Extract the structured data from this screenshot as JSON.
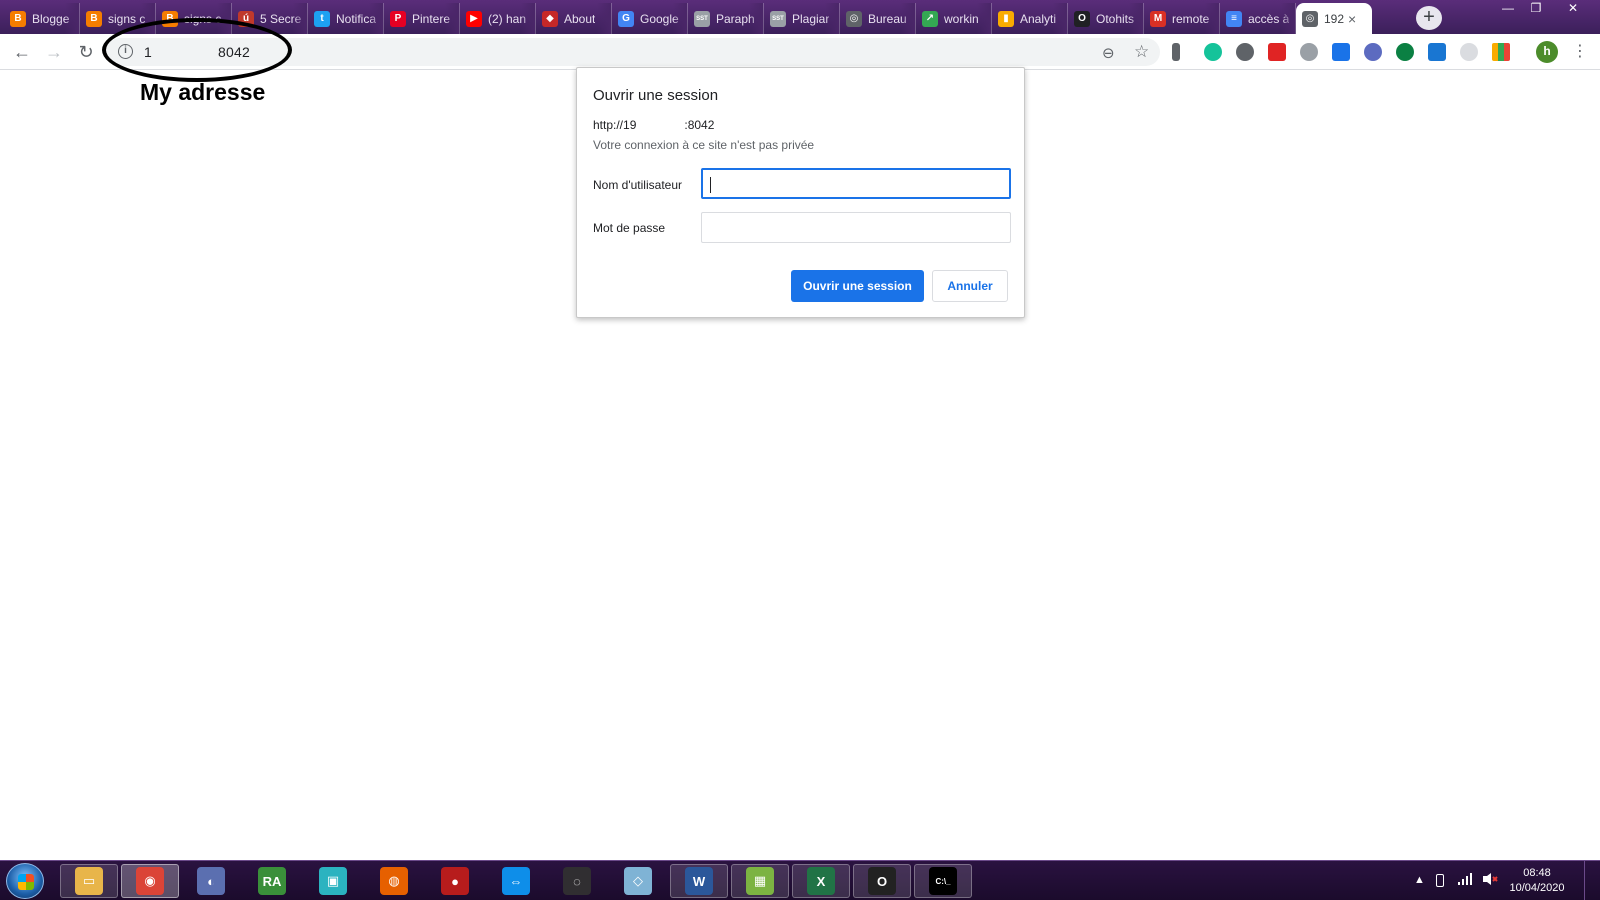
{
  "browser": {
    "tabs": [
      {
        "label": "Blogge",
        "icon": "blogger-icon",
        "color": "#f57d00",
        "glyph": "B"
      },
      {
        "label": "signs c",
        "icon": "blogger-icon",
        "color": "#f57d00",
        "glyph": "B"
      },
      {
        "label": "signs c",
        "icon": "blogger-icon",
        "color": "#f57d00",
        "glyph": "B"
      },
      {
        "label": "5 Secre",
        "icon": "article-icon",
        "color": "#c0392b",
        "glyph": "ú"
      },
      {
        "label": "Notifica",
        "icon": "twitter-icon",
        "color": "#1da1f2",
        "glyph": "t"
      },
      {
        "label": "Pintere",
        "icon": "pinterest-icon",
        "color": "#e60023",
        "glyph": "P"
      },
      {
        "label": "(2) han",
        "icon": "youtube-icon",
        "color": "#ff0000",
        "glyph": "▶"
      },
      {
        "label": "About",
        "icon": "gamepad-icon",
        "color": "#c62828",
        "glyph": "◆"
      },
      {
        "label": "Google",
        "icon": "google-translate-icon",
        "color": "#4285f4",
        "glyph": "G"
      },
      {
        "label": "Paraph",
        "icon": "sst-icon",
        "color": "#9aa0a6",
        "glyph": "SST"
      },
      {
        "label": "Plagiar",
        "icon": "sst-icon",
        "color": "#9aa0a6",
        "glyph": "SST"
      },
      {
        "label": "Bureau",
        "icon": "globe-icon",
        "color": "#5f6368",
        "glyph": "◎"
      },
      {
        "label": "workin",
        "icon": "trend-icon",
        "color": "#34a853",
        "glyph": "↗"
      },
      {
        "label": "Analyti",
        "icon": "analytics-icon",
        "color": "#f9ab00",
        "glyph": "▮"
      },
      {
        "label": "Otohits",
        "icon": "otohits-icon",
        "color": "#202124",
        "glyph": "O"
      },
      {
        "label": "remote",
        "icon": "gmail-icon",
        "color": "#d93025",
        "glyph": "M"
      },
      {
        "label": "accès à",
        "icon": "docs-icon",
        "color": "#4285f4",
        "glyph": "≡"
      },
      {
        "label": "192",
        "icon": "globe-icon",
        "color": "#5f6368",
        "glyph": "◎",
        "active": true
      }
    ],
    "new_tab_label": "+",
    "window_controls": {
      "minimize": "—",
      "restore": "❐",
      "close": "✕"
    },
    "nav": {
      "back": "←",
      "forward": "→",
      "reload": "↻"
    },
    "omnibox": {
      "url_prefix": "1",
      "url_suffix": "8042",
      "info_glyph": "i",
      "zoom_glyph": "⊖",
      "star_glyph": "☆"
    },
    "profile_initial": "h",
    "menu_glyph": "⋮"
  },
  "annotation": {
    "text": "My adresse"
  },
  "dialog": {
    "title": "Ouvrir une session",
    "url_start": "http://19",
    "url_end": ":8042",
    "subtitle": "Votre connexion à ce site n'est pas privée",
    "username_label": "Nom d'utilisateur",
    "username_value": "",
    "password_label": "Mot de passe",
    "password_value": "",
    "submit_label": "Ouvrir une session",
    "cancel_label": "Annuler"
  },
  "taskbar": {
    "clock_time": "08:48",
    "clock_date": "10/04/2020",
    "tray_arrow": "▲",
    "apps": [
      {
        "name": "file-explorer-icon",
        "glyph": "▭",
        "color": "#e8b54a",
        "style": "boxed"
      },
      {
        "name": "chrome-icon",
        "glyph": "◉",
        "color": "#db4437",
        "style": "pressed"
      },
      {
        "name": "app-icon-circle",
        "glyph": "◐",
        "color": "#5b6fb0",
        "style": "plain"
      },
      {
        "name": "ra-icon",
        "glyph": "RA",
        "color": "#3a8f3a",
        "style": "plain"
      },
      {
        "name": "presentation-icon",
        "glyph": "▣",
        "color": "#2bb3c0",
        "style": "plain"
      },
      {
        "name": "firefox-icon",
        "glyph": "◍",
        "color": "#e66000",
        "style": "plain"
      },
      {
        "name": "red-ball-icon",
        "glyph": "●",
        "color": "#b71c1c",
        "style": "plain"
      },
      {
        "name": "teamviewer-icon",
        "glyph": "⇔",
        "color": "#0e8ee9",
        "style": "plain"
      },
      {
        "name": "obs-icon",
        "glyph": "◌",
        "color": "#302e31",
        "style": "plain"
      },
      {
        "name": "glass-app-icon",
        "glyph": "◇",
        "color": "#7fb3d5",
        "style": "plain"
      },
      {
        "name": "word-icon",
        "glyph": "W",
        "color": "#2b579a",
        "style": "boxed"
      },
      {
        "name": "media-app-icon",
        "glyph": "▦",
        "color": "#7cb342",
        "style": "boxed"
      },
      {
        "name": "excel-icon",
        "glyph": "X",
        "color": "#217346",
        "style": "boxed"
      },
      {
        "name": "otohits-app-icon",
        "glyph": "O",
        "color": "#222222",
        "style": "boxed"
      },
      {
        "name": "cmd-icon",
        "glyph": "C:\\_",
        "color": "#000000",
        "style": "boxed"
      }
    ]
  }
}
